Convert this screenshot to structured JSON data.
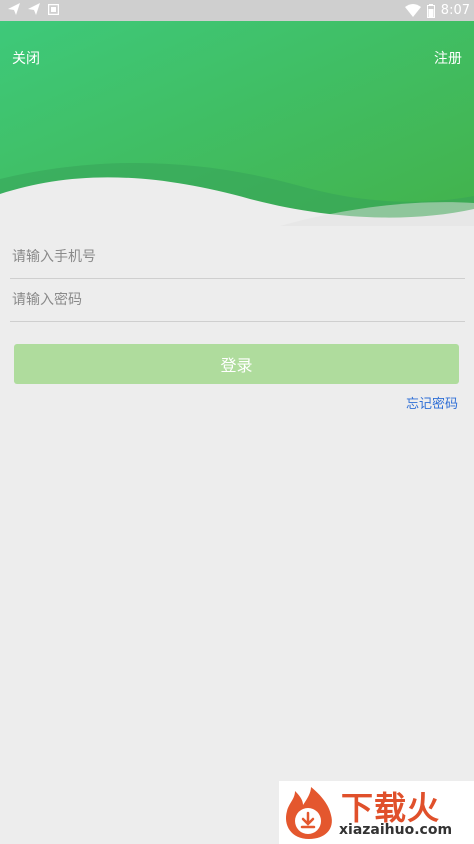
{
  "status_bar": {
    "time": "8:07",
    "icons": [
      "send-icon",
      "send-icon",
      "notification-icon",
      "wifi-icon",
      "battery-icon"
    ]
  },
  "header": {
    "close_label": "关闭",
    "register_label": "注册",
    "gradient": [
      "#3dc878",
      "#43b24a"
    ]
  },
  "form": {
    "phone_placeholder": "请输入手机号",
    "phone_value": "",
    "password_placeholder": "请输入密码",
    "password_value": "",
    "login_label": "登录",
    "forgot_label": "忘记密码"
  },
  "colors": {
    "background": "#ededed",
    "login_button": "#afdc9d",
    "link": "#2f6fd6",
    "accent": "#3fbf6a"
  },
  "watermark": {
    "title": "下载火",
    "domain": "xiazaihuo.com"
  }
}
